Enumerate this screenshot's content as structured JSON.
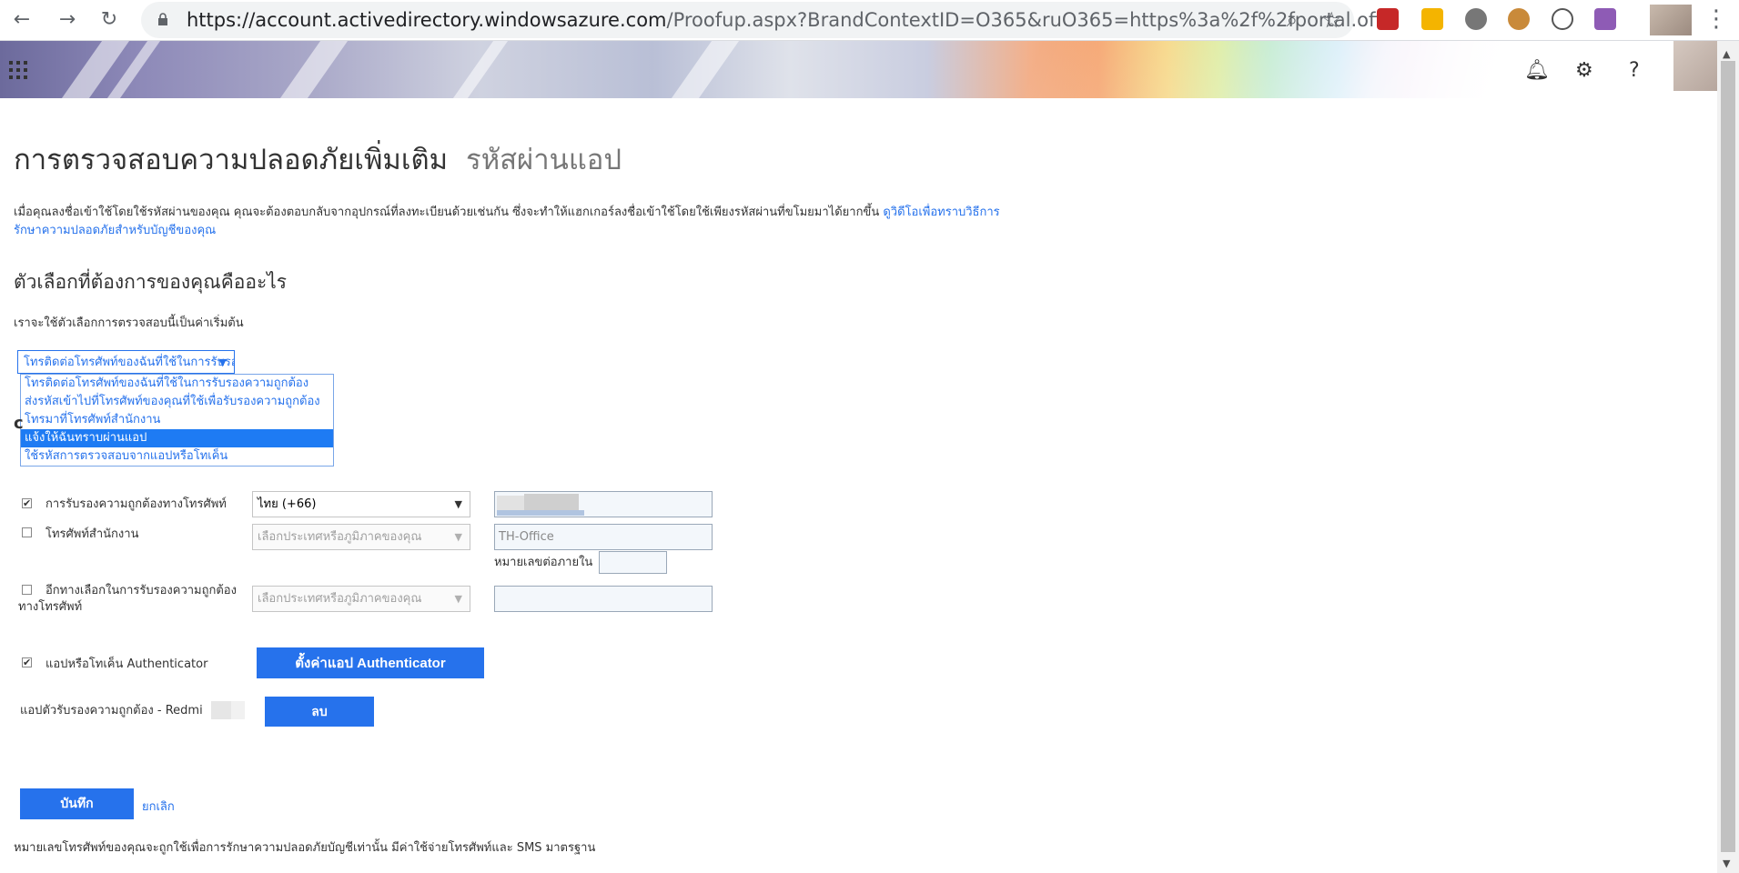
{
  "browser": {
    "url_main": "https://account.activedirectory.windowsazure.com",
    "url_rest": "/Proofup.aspx?BrandContextID=O365&ruO365=https%3a%2f%2fportal.offi..."
  },
  "page": {
    "title": "การตรวจสอบความปลอดภัยเพิ่มเติม",
    "subtitle": "รหัสผ่านแอป",
    "intro_text": "เมื่อคุณลงชื่อเข้าใช้โดยใช้รหัสผ่านของคุณ คุณจะต้องตอบกลับจากอุปกรณ์ที่ลงทะเบียนด้วยเช่นกัน ซึ่งจะทำให้แฮกเกอร์ลงชื่อเข้าใช้โดยใช้เพียงรหัสผ่านที่ขโมยมาได้ยากขึ้น",
    "intro_link": "ดูวิดีโอเพื่อทราบวิธีการรักษาความปลอดภัยสำหรับบัญชีของคุณ",
    "question_heading": "ตัวเลือกที่ต้องการของคุณคืออะไร",
    "default_label": "เราจะใช้ตัวเลือกการตรวจสอบนี้เป็นค่าเริ่มต้น"
  },
  "default_select": {
    "value": "โทรติดต่อโทรศัพท์ของฉันที่ใช้ในการรับรองความถูกต้อง",
    "options": [
      "โทรติดต่อโทรศัพท์ของฉันที่ใช้ในการรับรองความถูกต้อง",
      "ส่งรหัสเข้าไปที่โทรศัพท์ของคุณที่ใช้เพื่อรับรองความถูกต้อง",
      "โทรมาที่โทรศัพท์สำนักงาน",
      "แจ้งให้ฉันทราบผ่านแอป",
      "ใช้รหัสการตรวจสอบจากแอปหรือโทเค็น"
    ],
    "selected_index": 3
  },
  "methods": {
    "auth_phone": {
      "label": "การรับรองความถูกต้องทางโทรศัพท์",
      "checked": true,
      "country": "ไทย (+66)"
    },
    "office_phone": {
      "label": "โทรศัพท์สำนักงาน",
      "checked": false,
      "country_placeholder": "เลือกประเทศหรือภูมิภาคของคุณ",
      "phone_value": "TH-Office",
      "extension_label": "หมายเลขต่อภายใน"
    },
    "alt_phone": {
      "label": "อีกทางเลือกในการรับรองความถูกต้องทางโทรศัพท์",
      "checked": false,
      "country_placeholder": "เลือกประเทศหรือภูมิภาคของคุณ"
    },
    "authenticator": {
      "label": "แอปหรือโทเค็น Authenticator",
      "checked": true,
      "setup_button": "ตั้งค่าแอป Authenticator"
    },
    "registered_app": {
      "label": "แอปตัวรับรองความถูกต้อง - Redmi",
      "delete_button": "ลบ"
    }
  },
  "actions": {
    "save": "บันทึก",
    "cancel": "ยกเลิก"
  },
  "footer_text": "หมายเลขโทรศัพท์ของคุณจะถูกใช้เพื่อการรักษาความปลอดภัยบัญชีเท่านั้น มีค่าใช้จ่ายโทรศัพท์และ SMS มาตรฐาน",
  "colors": {
    "accent": "#2672ec",
    "list_selected": "#1e7bf3"
  }
}
